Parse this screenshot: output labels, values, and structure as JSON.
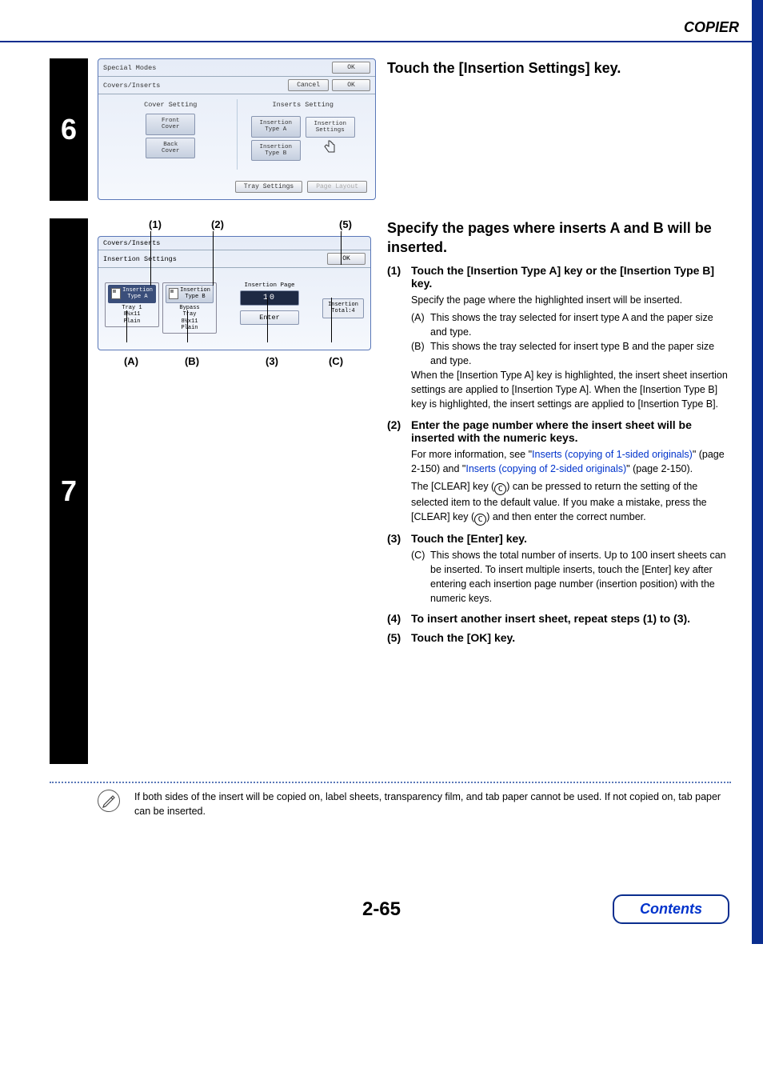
{
  "header": {
    "section": "COPIER"
  },
  "step6": {
    "number": "6",
    "instruction": "Touch the [Insertion Settings] key.",
    "panel": {
      "title": "Special Modes",
      "ok": "OK",
      "subtitle": "Covers/Inserts",
      "cancel": "Cancel",
      "ok2": "OK",
      "left_head": "Cover Setting",
      "right_head": "Inserts Setting",
      "front_cover": "Front\nCover",
      "back_cover": "Back\nCover",
      "ins_a": "Insertion\nType A",
      "ins_b": "Insertion\nType B",
      "ins_settings": "Insertion\nSettings",
      "tray_settings": "Tray Settings",
      "page_layout": "Page Layout"
    }
  },
  "step7": {
    "number": "7",
    "heading": "Specify the pages where inserts A and B will be inserted.",
    "callouts_top": {
      "c1": "(1)",
      "c2": "(2)",
      "c5": "(5)"
    },
    "callouts_bot": {
      "cA": "(A)",
      "cB": "(B)",
      "c3": "(3)",
      "cC": "(C)"
    },
    "panel": {
      "row1": "Covers/Inserts",
      "row2": "Insertion Settings",
      "ok": "OK",
      "typeA": "Insertion\nType A",
      "typeA_sub": "Tray 1\n8½x11\nPlain",
      "typeB": "Insertion\nType B",
      "typeB_sub": "Bypass\nTray\n8½x11\nPlain",
      "page_label": "Insertion Page",
      "page_value": "10",
      "enter": "Enter",
      "total": "Insertion\nTotal:4"
    },
    "steps": {
      "s1_num": "(1)",
      "s1_title": "Touch the [Insertion Type A] key or the [Insertion Type B] key.",
      "s1_body": "Specify the page where the highlighted insert will be inserted.",
      "s1_A_lbl": "(A)",
      "s1_A": "This shows the tray selected for insert type A and the paper size and type.",
      "s1_B_lbl": "(B)",
      "s1_B": "This shows the tray selected for insert type B and the paper size and type.",
      "s1_tail": "When the [Insertion Type A] key is highlighted, the insert sheet insertion settings are applied to [Insertion Type A]. When the [Insertion Type B] key is highlighted, the insert settings are applied to [Insertion Type B].",
      "s2_num": "(2)",
      "s2_title": "Enter the page number where the insert sheet will be inserted with the numeric keys.",
      "s2_body_pre": "For more information, see \"",
      "s2_link1": "Inserts (copying of 1-sided originals)",
      "s2_body_mid": "\" (page 2-150) and \"",
      "s2_link2": "Inserts (copying of 2-sided originals)",
      "s2_body_post": "\" (page 2-150).",
      "s2_clear": "The [CLEAR] key (",
      "s2_clear2": ") can be pressed to return the setting of the selected item to the default value. If you make a mistake, press the [CLEAR] key (",
      "s2_clear3": ") and then enter the correct number.",
      "clear_glyph": "C",
      "s3_num": "(3)",
      "s3_title": "Touch the [Enter] key.",
      "s3_C_lbl": "(C)",
      "s3_C": "This shows the total number of inserts. Up to 100 insert sheets can be inserted. To insert multiple inserts, touch the [Enter] key after entering each insertion page number (insertion position) with the numeric keys.",
      "s4_num": "(4)",
      "s4_title": "To insert another insert sheet, repeat steps (1) to (3).",
      "s5_num": "(5)",
      "s5_title": "Touch the [OK] key."
    },
    "note": "If both sides of the insert will be copied on, label sheets, transparency film, and tab paper cannot be used. If not copied on, tab paper can be inserted."
  },
  "footer": {
    "page": "2-65",
    "contents": "Contents"
  }
}
